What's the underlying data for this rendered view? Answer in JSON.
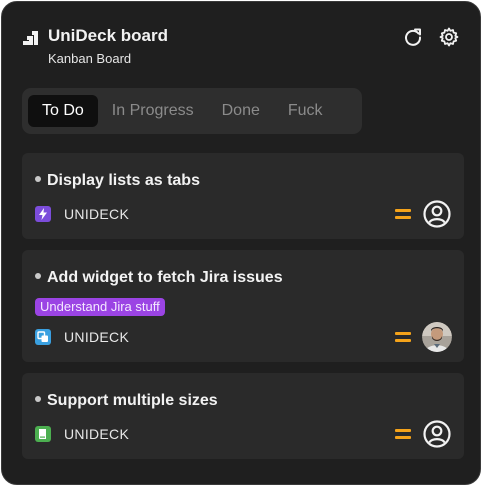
{
  "header": {
    "title": "UniDeck board",
    "subtitle": "Kanban Board",
    "logo_icon": "stairs-logo-icon",
    "refresh_icon": "refresh-icon",
    "settings_icon": "gear-icon"
  },
  "tabs": [
    {
      "label": "To Do",
      "active": true
    },
    {
      "label": "In Progress",
      "active": false
    },
    {
      "label": "Done",
      "active": false
    },
    {
      "label": "Fuck",
      "active": false
    }
  ],
  "cards": [
    {
      "title": "Display lists as tabs",
      "project": "UNIDECK",
      "project_icon": "lightning-icon",
      "project_color": "#7c4ddb",
      "priority": "medium",
      "priority_color": "#f5a31a",
      "assignee": "unassigned-user-icon"
    },
    {
      "title": "Add widget to fetch Jira issues",
      "label": "Understand Jira stuff",
      "label_color": "#9b44e4",
      "project": "UNIDECK",
      "project_icon": "layers-icon",
      "project_color": "#3aa0e0",
      "priority": "medium",
      "priority_color": "#f5a31a",
      "assignee": "user-avatar-photo"
    },
    {
      "title": "Support multiple sizes",
      "project": "UNIDECK",
      "project_icon": "book-icon",
      "project_color": "#4caf50",
      "priority": "medium",
      "priority_color": "#f5a31a",
      "assignee": "unassigned-user-icon"
    }
  ]
}
